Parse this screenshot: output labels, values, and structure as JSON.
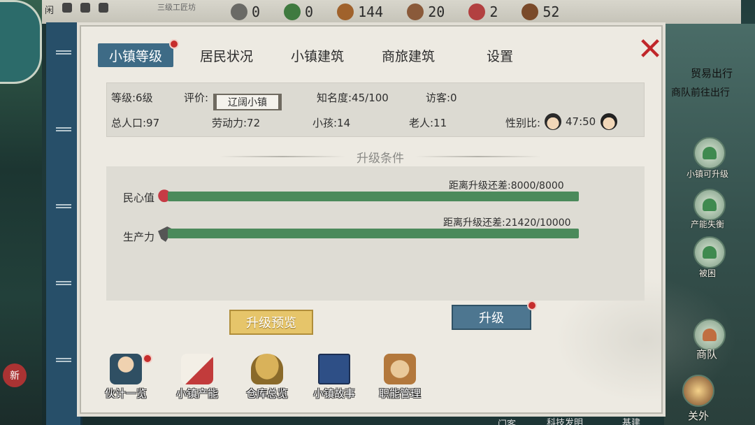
{
  "hud": {
    "left_icons": [
      "闲"
    ],
    "subtitle": "三级工匠坊",
    "resources": [
      {
        "icon": "tools-icon",
        "value": "0",
        "color": "#6a6a66"
      },
      {
        "icon": "herb-icon",
        "value": "0",
        "color": "#3f7a3f"
      },
      {
        "icon": "wood-icon",
        "value": "144",
        "color": "#a0622c"
      },
      {
        "icon": "ore-icon",
        "value": "20",
        "color": "#8a5a3a"
      },
      {
        "icon": "cloth-icon",
        "value": "2",
        "color": "#b24040"
      },
      {
        "icon": "food-icon",
        "value": "52",
        "color": "#7a4a2a"
      }
    ]
  },
  "tabs": [
    {
      "label": "小镇等级",
      "active": true,
      "badge": true
    },
    {
      "label": "居民状况",
      "active": false,
      "badge": false
    },
    {
      "label": "小镇建筑",
      "active": false,
      "badge": false
    },
    {
      "label": "商旅建筑",
      "active": false,
      "badge": false
    },
    {
      "label": "设置",
      "active": false,
      "badge": false
    }
  ],
  "info": {
    "level": "等级:6级",
    "rating_label": "评价:",
    "rating_value": "辽阔小镇",
    "fame": "知名度:45/100",
    "visitors": "访客:0",
    "population": "总人口:97",
    "labor": "劳动力:72",
    "children": "小孩:14",
    "elders": "老人:11",
    "gender_label": "性别比:",
    "gender_value": "47:50"
  },
  "conditions": {
    "title": "升级条件",
    "items": [
      {
        "label": "民心值",
        "need": "距离升级还差:8000/8000",
        "progress": 1.0,
        "icon": "heart-icon"
      },
      {
        "label": "生产力",
        "need": "距离升级还差:21420/10000",
        "progress": 1.0,
        "icon": "axe-icon"
      }
    ]
  },
  "buttons": {
    "preview": "升级预览",
    "upgrade": "升级",
    "close": "✕"
  },
  "toolbar": [
    {
      "label": "伙计一览",
      "icon": "worker-icon",
      "badge": true
    },
    {
      "label": "小镇产能",
      "icon": "scroll-icon",
      "badge": false
    },
    {
      "label": "仓库总览",
      "icon": "granary-icon",
      "badge": false
    },
    {
      "label": "小镇故事",
      "icon": "book-icon",
      "badge": false
    },
    {
      "label": "职能管理",
      "icon": "tools-icon",
      "badge": false
    }
  ],
  "side": {
    "trade": "贸易出行",
    "trade_sub": "商队前往出行",
    "btn1": "小镇可升级",
    "btn2": "产能失衡",
    "btn3": "被困",
    "btn4": "商队",
    "btn5": "关外",
    "left_badge": "新",
    "bottom": [
      "门客",
      "科技发明",
      "基建"
    ]
  }
}
